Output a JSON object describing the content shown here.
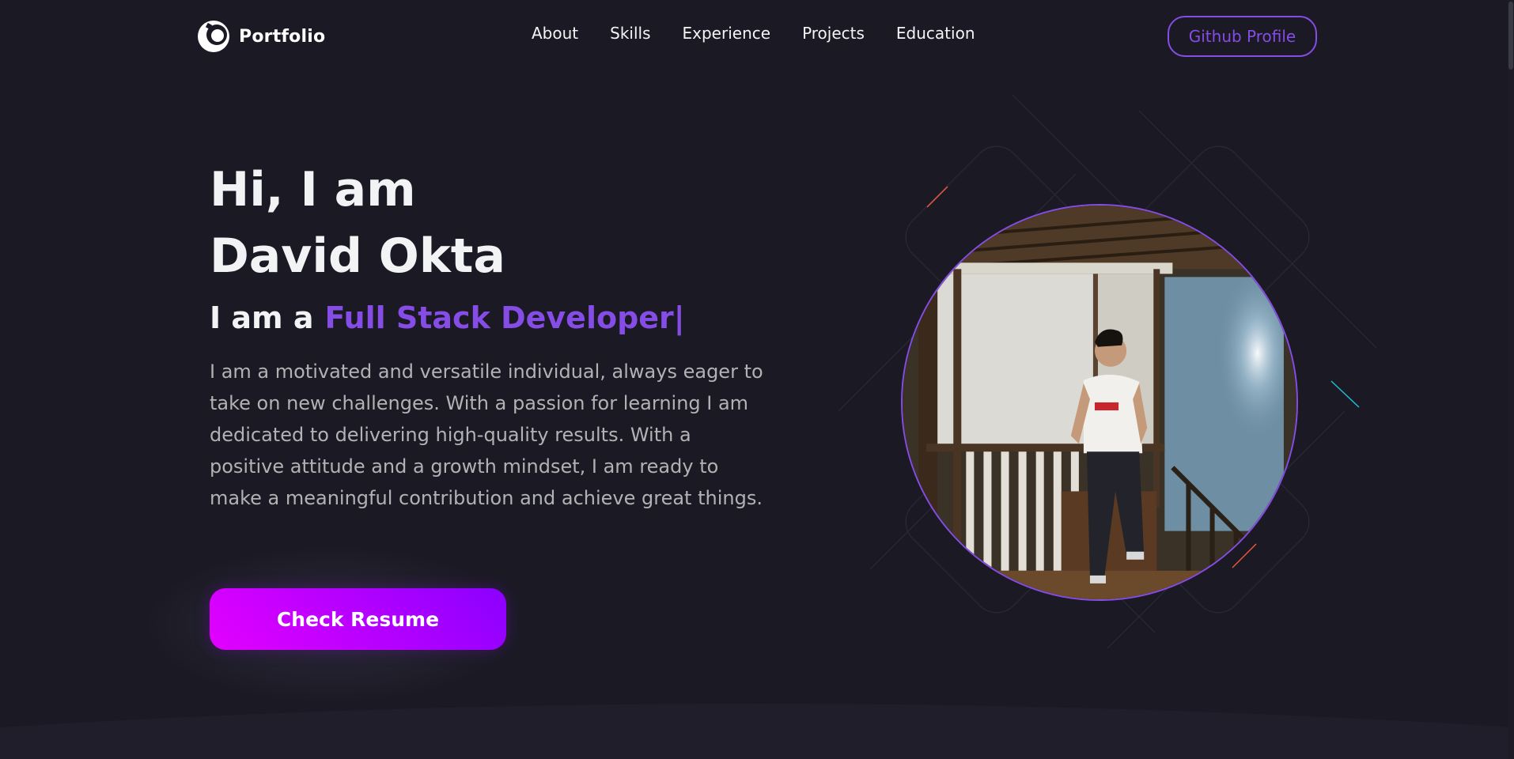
{
  "header": {
    "logo_text": "Portfolio",
    "nav": [
      "About",
      "Skills",
      "Experience",
      "Projects",
      "Education"
    ],
    "github_label": "Github Profile"
  },
  "hero": {
    "title_line1": "Hi, I am",
    "title_line2": "David Okta",
    "roles_prefix": "I am a",
    "roles_typed": "Full Stack Developer",
    "cursor": "|",
    "description": "I am a motivated and versatile individual, always eager to take on new challenges. With a passion for learning I am dedicated to delivering high-quality results. With a positive attitude and a growth mindset, I am ready to make a meaningful contribution and achieve great things.",
    "resume_label": "Check Resume"
  },
  "colors": {
    "background": "#1b1a24",
    "accent": "#854ce6",
    "text_primary": "#f2f3f4",
    "text_secondary": "#b1b2b3",
    "button_gradient_start": "#e400ff",
    "button_gradient_end": "#8a00ff"
  },
  "icons": [
    "logo-icon",
    "profile-photo"
  ]
}
